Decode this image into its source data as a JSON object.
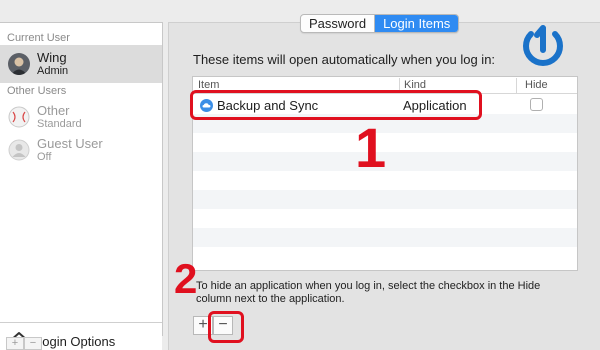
{
  "sidebar": {
    "current_user_header": "Current User",
    "other_users_header": "Other Users",
    "users": [
      {
        "name": "Wing",
        "role": "Admin"
      },
      {
        "name": "Other",
        "role": "Standard"
      },
      {
        "name": "Guest User",
        "role": "Off"
      }
    ],
    "login_options_label": "Login Options",
    "add_symbol": "+",
    "remove_symbol": "−"
  },
  "tabs": [
    {
      "label": "Password",
      "active": false
    },
    {
      "label": "Login Items",
      "active": true
    }
  ],
  "pane": {
    "intro": "These items will open automatically when you log in:",
    "columns": {
      "item": "Item",
      "kind": "Kind",
      "hide": "Hide"
    },
    "rows": [
      {
        "item": "Backup and Sync",
        "kind": "Application",
        "hide": false
      }
    ],
    "footnote": "To hide an application when you log in, select the checkbox in the Hide column next to the application.",
    "add_symbol": "+",
    "remove_symbol": "−"
  },
  "annotations": {
    "step1": "1",
    "step2": "2"
  },
  "colors": {
    "accent": "#2f8bf2",
    "annotation_red": "#e0101f"
  },
  "icons": [
    "house-icon",
    "power-icon",
    "cloud-icon",
    "avatar"
  ]
}
